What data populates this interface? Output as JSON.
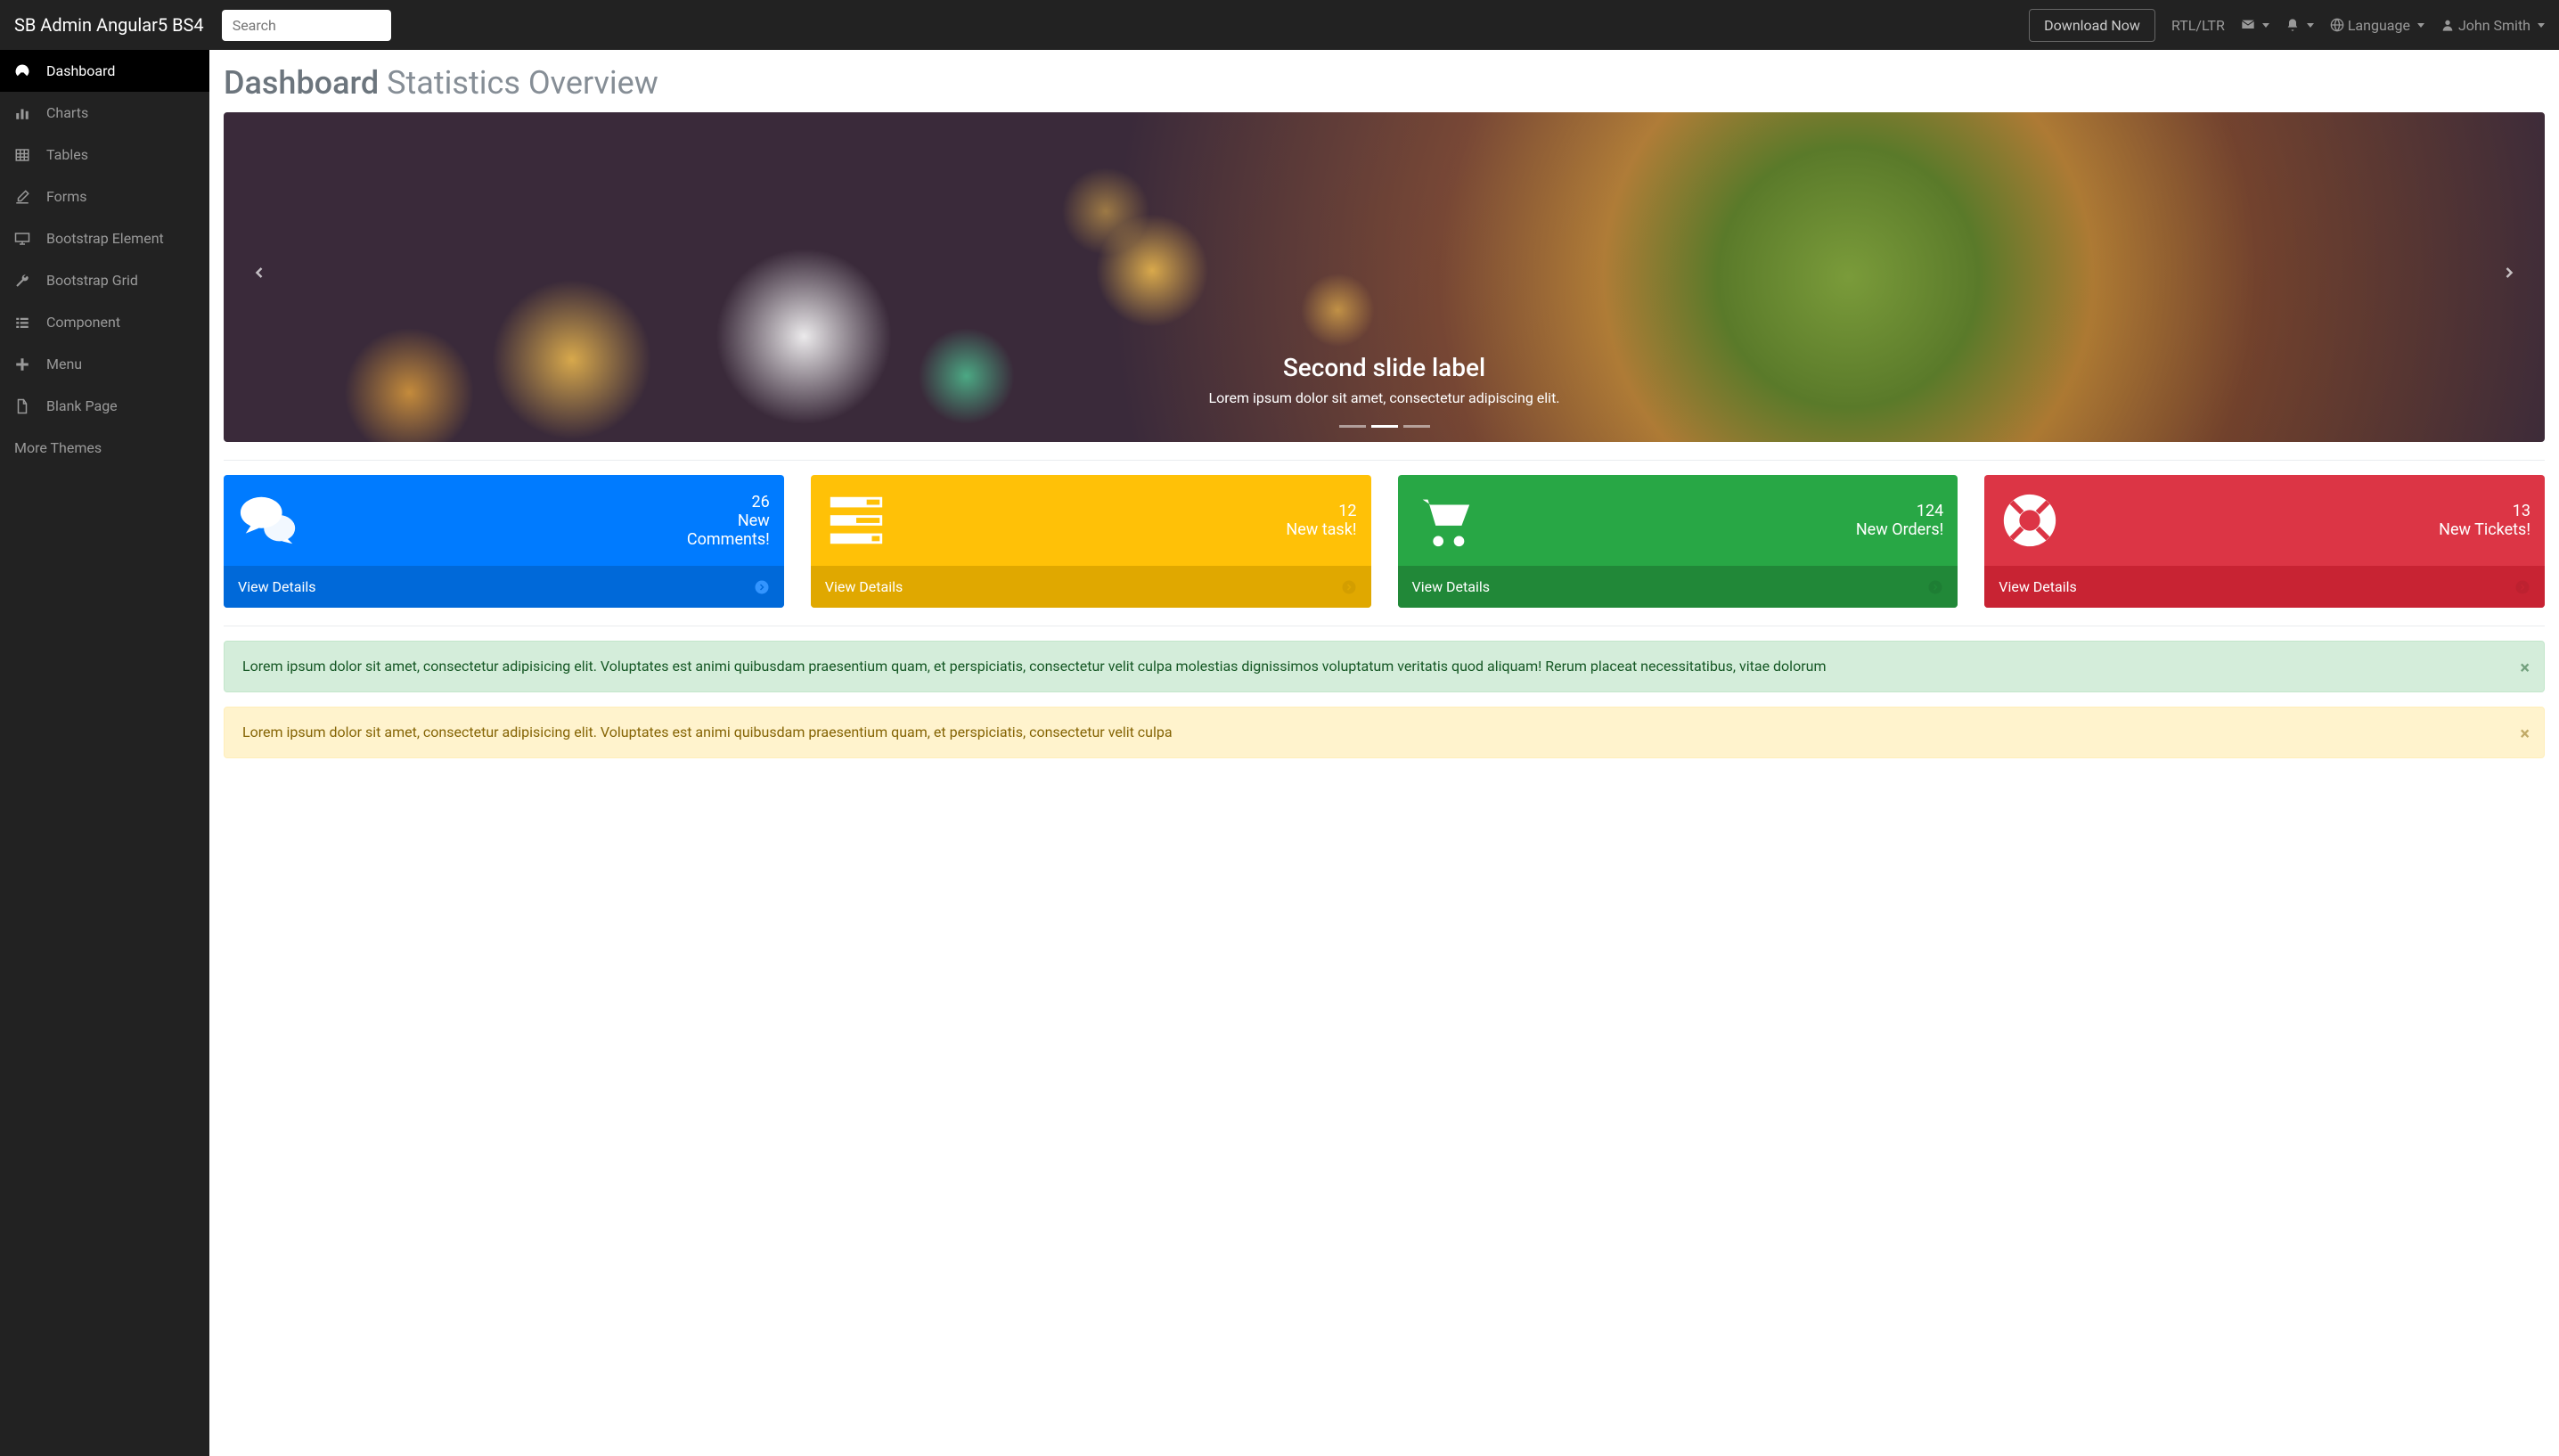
{
  "brand": "SB Admin Angular5 BS4",
  "search": {
    "placeholder": "Search"
  },
  "topbar": {
    "download": "Download Now",
    "rtl": "RTL/LTR",
    "language": "Language",
    "user": "John Smith"
  },
  "sidebar": {
    "items": [
      {
        "label": "Dashboard"
      },
      {
        "label": "Charts"
      },
      {
        "label": "Tables"
      },
      {
        "label": "Forms"
      },
      {
        "label": "Bootstrap Element"
      },
      {
        "label": "Bootstrap Grid"
      },
      {
        "label": "Component"
      },
      {
        "label": "Menu"
      },
      {
        "label": "Blank Page"
      }
    ],
    "more": "More Themes"
  },
  "page": {
    "title": "Dashboard",
    "subtitle": "Statistics Overview"
  },
  "carousel": {
    "title": "Second slide label",
    "text": "Lorem ipsum dolor sit amet, consectetur adipiscing elit."
  },
  "stats": [
    {
      "num": "26",
      "label1": "New",
      "label2": "Comments!",
      "link": "View Details"
    },
    {
      "num": "12",
      "label1": "New task!",
      "label2": "",
      "link": "View Details"
    },
    {
      "num": "124",
      "label1": "New Orders!",
      "label2": "",
      "link": "View Details"
    },
    {
      "num": "13",
      "label1": "New Tickets!",
      "label2": "",
      "link": "View Details"
    }
  ],
  "alerts": {
    "success": "Lorem ipsum dolor sit amet, consectetur adipisicing elit. Voluptates est animi quibusdam praesentium quam, et perspiciatis, consectetur velit culpa molestias dignissimos voluptatum veritatis quod aliquam! Rerum placeat necessitatibus, vitae dolorum",
    "warning": "Lorem ipsum dolor sit amet, consectetur adipisicing elit. Voluptates est animi quibusdam praesentium quam, et perspiciatis, consectetur velit culpa"
  }
}
